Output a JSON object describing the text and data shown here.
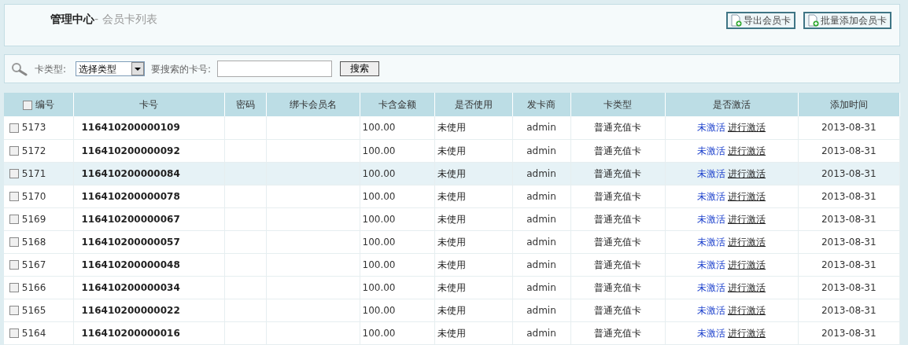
{
  "header": {
    "title": "管理中心",
    "subtitle": "- 会员卡列表",
    "buttons": [
      "导出会员卡",
      "批量添加会员卡"
    ]
  },
  "search": {
    "type_label": "卡类型:",
    "type_value": "选择类型",
    "number_label": "要搜索的卡号:",
    "button": "搜索"
  },
  "table": {
    "select_all_checked": false,
    "columns": [
      "编号",
      "卡号",
      "密码",
      "绑卡会员名",
      "卡含金额",
      "是否使用",
      "发卡商",
      "卡类型",
      "是否激活",
      "添加时间"
    ],
    "rows": [
      {
        "id": "5173",
        "card_no": "116410200000109",
        "amount": "100.00",
        "used": "未使用",
        "issuer": "admin",
        "card_type": "普通充值卡",
        "status": "未激活",
        "action": "进行激活",
        "date": "2013-08-31",
        "checked": false,
        "highlighted": false
      },
      {
        "id": "5172",
        "card_no": "116410200000092",
        "amount": "100.00",
        "used": "未使用",
        "issuer": "admin",
        "card_type": "普通充值卡",
        "status": "未激活",
        "action": "进行激活",
        "date": "2013-08-31",
        "checked": false,
        "highlighted": false
      },
      {
        "id": "5171",
        "card_no": "116410200000084",
        "amount": "100.00",
        "used": "未使用",
        "issuer": "admin",
        "card_type": "普通充值卡",
        "status": "未激活",
        "action": "进行激活",
        "date": "2013-08-31",
        "checked": false,
        "highlighted": true
      },
      {
        "id": "5170",
        "card_no": "116410200000078",
        "amount": "100.00",
        "used": "未使用",
        "issuer": "admin",
        "card_type": "普通充值卡",
        "status": "未激活",
        "action": "进行激活",
        "date": "2013-08-31",
        "checked": false,
        "highlighted": false
      },
      {
        "id": "5169",
        "card_no": "116410200000067",
        "amount": "100.00",
        "used": "未使用",
        "issuer": "admin",
        "card_type": "普通充值卡",
        "status": "未激活",
        "action": "进行激活",
        "date": "2013-08-31",
        "checked": false,
        "highlighted": false
      },
      {
        "id": "5168",
        "card_no": "116410200000057",
        "amount": "100.00",
        "used": "未使用",
        "issuer": "admin",
        "card_type": "普通充值卡",
        "status": "未激活",
        "action": "进行激活",
        "date": "2013-08-31",
        "checked": false,
        "highlighted": false
      },
      {
        "id": "5167",
        "card_no": "116410200000048",
        "amount": "100.00",
        "used": "未使用",
        "issuer": "admin",
        "card_type": "普通充值卡",
        "status": "未激活",
        "action": "进行激活",
        "date": "2013-08-31",
        "checked": false,
        "highlighted": false
      },
      {
        "id": "5166",
        "card_no": "116410200000034",
        "amount": "100.00",
        "used": "未使用",
        "issuer": "admin",
        "card_type": "普通充值卡",
        "status": "未激活",
        "action": "进行激活",
        "date": "2013-08-31",
        "checked": false,
        "highlighted": false
      },
      {
        "id": "5165",
        "card_no": "116410200000022",
        "amount": "100.00",
        "used": "未使用",
        "issuer": "admin",
        "card_type": "普通充值卡",
        "status": "未激活",
        "action": "进行激活",
        "date": "2013-08-31",
        "checked": false,
        "highlighted": false
      },
      {
        "id": "5164",
        "card_no": "116410200000016",
        "amount": "100.00",
        "used": "未使用",
        "issuer": "admin",
        "card_type": "普通充值卡",
        "status": "未激活",
        "action": "进行激活",
        "date": "2013-08-31",
        "checked": false,
        "highlighted": false
      }
    ]
  }
}
